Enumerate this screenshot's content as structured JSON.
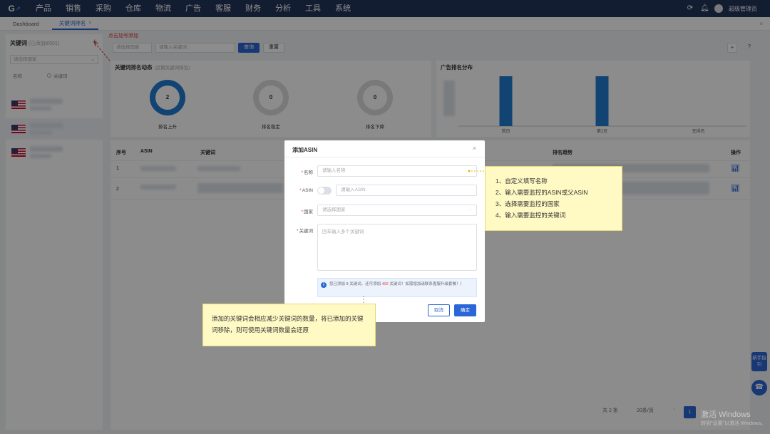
{
  "nav": {
    "logo": "G",
    "items": [
      "产品",
      "销售",
      "采购",
      "仓库",
      "物流",
      "广告",
      "客服",
      "财务",
      "分析",
      "工具",
      "系统"
    ],
    "user": "超级管理员"
  },
  "tabs": {
    "items": [
      {
        "label": "Dashboard"
      },
      {
        "label": "关键词排名"
      }
    ],
    "close_glyph": "×"
  },
  "left_panel": {
    "title": "关键词",
    "title_sub": "(已添加8/501)",
    "select_placeholder": "请选择国家",
    "radio_1": "名称",
    "radio_2": "关键词",
    "annotation": "点击加号添加"
  },
  "toolbar": {
    "country_placeholder": "请选择国家",
    "search_placeholder": "请输入关键词",
    "search_label": "查询",
    "reset_label": "重置"
  },
  "stats_card": {
    "title": "关键词排名动态",
    "subtitle": "(近期关键词排名)",
    "donuts": [
      {
        "value": "2",
        "label": "排名上升",
        "color": "#1f7bd1"
      },
      {
        "value": "0",
        "label": "排名稳定",
        "color": "#dcdcdc"
      },
      {
        "value": "0",
        "label": "排名下降",
        "color": "#dcdcdc"
      }
    ]
  },
  "ad_card": {
    "title": "广告排名分布",
    "bars": [
      {
        "label": "首页",
        "value": 1
      },
      {
        "label": "第2页",
        "value": 1
      },
      {
        "label": "无排名",
        "value": 0
      }
    ]
  },
  "table": {
    "headers": [
      "序号",
      "ASIN",
      "关键词",
      "排名趋势",
      "操作"
    ],
    "rows": [
      {
        "index": "1"
      },
      {
        "index": "2"
      }
    ]
  },
  "modal": {
    "title": "添加ASIN",
    "name_label": "名称",
    "name_placeholder": "请输入名称",
    "asin_label": "ASIN",
    "asin_placeholder": "请输入ASIN",
    "country_label": "国家",
    "country_placeholder": "请选择国家",
    "keyword_label": "关键词",
    "keyword_placeholder": "回车输入多个关键词",
    "info_text_1": "您已添加 8 关键词，还可添加",
    "info_count": "492",
    "info_text_2": "关键词！如需增加请联系客服升级套餐！）",
    "cancel_label": "取消",
    "ok_label": "确定"
  },
  "callout1": {
    "lines": [
      "1、自定义填写名称",
      "2、输入需要监控的ASIN或父ASIN",
      "3、选择需要监控的国家",
      "4、输入需要监控的关键词"
    ]
  },
  "callout2": {
    "text": "添加的关键词会相应减少关键词的数量，将已添加的关键词移除，则可使用关键词数量会还原"
  },
  "side": {
    "guide": "新手指引"
  },
  "pager": {
    "total": "共 2 条",
    "per_page": "20条/页",
    "current": "1"
  },
  "watermark": {
    "line1": "激活 Windows",
    "line2": "转到\"设置\"以激活 Windows。"
  }
}
